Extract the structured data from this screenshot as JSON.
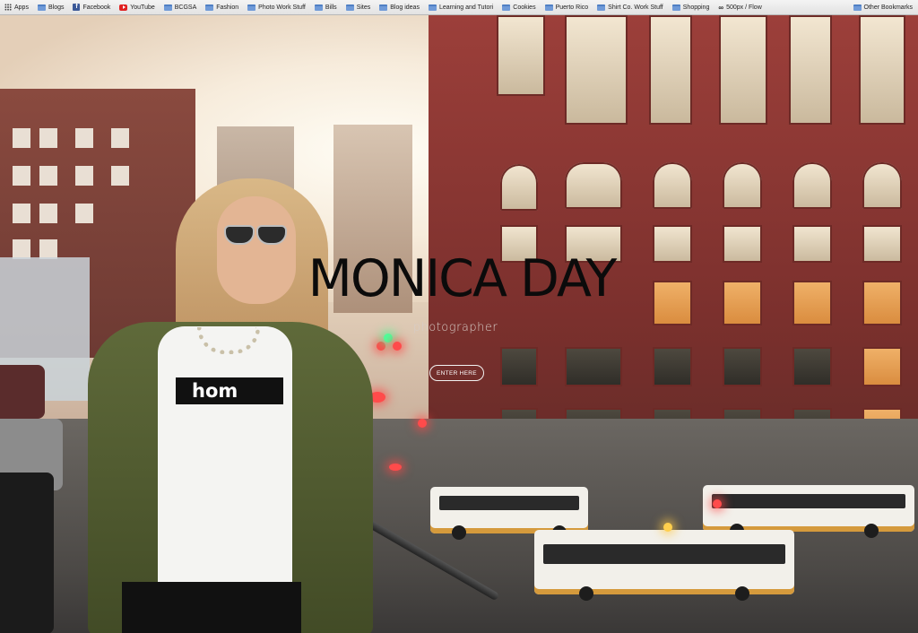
{
  "bookmarks_bar": {
    "items": [
      {
        "label": "Apps",
        "icon": "apps-grid-icon"
      },
      {
        "label": "Blogs",
        "icon": "folder-icon"
      },
      {
        "label": "Facebook",
        "icon": "facebook-icon"
      },
      {
        "label": "YouTube",
        "icon": "youtube-icon"
      },
      {
        "label": "BCGSA",
        "icon": "folder-icon"
      },
      {
        "label": "Fashion",
        "icon": "folder-icon"
      },
      {
        "label": "Photo Work Stuff",
        "icon": "folder-icon"
      },
      {
        "label": "Bills",
        "icon": "folder-icon"
      },
      {
        "label": "Sites",
        "icon": "folder-icon"
      },
      {
        "label": "Blog ideas",
        "icon": "folder-icon"
      },
      {
        "label": "Learning and Tutori",
        "icon": "folder-icon"
      },
      {
        "label": "Cookies",
        "icon": "folder-icon"
      },
      {
        "label": "Puerto Rico",
        "icon": "folder-icon"
      },
      {
        "label": "Shirt Co. Work Stuff",
        "icon": "folder-icon"
      },
      {
        "label": "Shopping",
        "icon": "folder-icon"
      },
      {
        "label": "500px / Flow",
        "icon": "infinity-icon"
      }
    ],
    "other": {
      "label": "Other Bookmarks",
      "icon": "folder-icon"
    }
  },
  "hero": {
    "title": "MONICA DAY",
    "subtitle": "photographer",
    "enter_label": "ENTER HERE",
    "shirt_text": "hom"
  },
  "colors": {
    "title": "#0b0b0b",
    "subtitle": "#d7cdc7",
    "button_border": "#f2f2f2",
    "building": "#8a3a35"
  }
}
